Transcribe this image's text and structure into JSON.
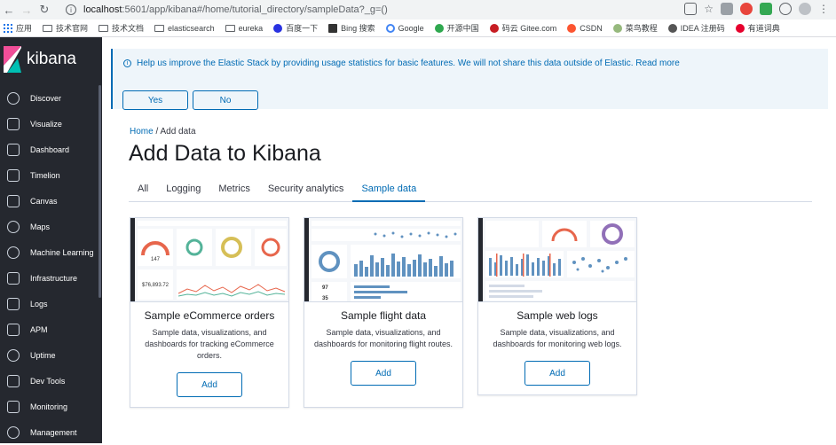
{
  "browser": {
    "url_host": "localhost",
    "url_rest": ":5601/app/kibana#/home/tutorial_directory/sampleData?_g=()",
    "bookmarks": [
      "应用",
      "技术官网",
      "技术文档",
      "elasticsearch",
      "eureka",
      "百度一下",
      "Bing 搜索",
      "Google",
      "开源中国",
      "码云 Gitee.com",
      "CSDN",
      "菜鸟教程",
      "IDEA 注册码",
      "有道词典"
    ]
  },
  "sidebar": {
    "logo": "kibana",
    "items": [
      "Discover",
      "Visualize",
      "Dashboard",
      "Timelion",
      "Canvas",
      "Maps",
      "Machine Learning",
      "Infrastructure",
      "Logs",
      "APM",
      "Uptime",
      "Dev Tools",
      "Monitoring",
      "Management"
    ]
  },
  "callout": {
    "text": "Help us improve the Elastic Stack by providing usage statistics for basic features. We will not share this data outside of Elastic. Read more",
    "yes": "Yes",
    "no": "No"
  },
  "breadcrumb": {
    "home": "Home",
    "sep": " / ",
    "current": "Add data"
  },
  "title": "Add Data to Kibana",
  "tabs": [
    "All",
    "Logging",
    "Metrics",
    "Security analytics",
    "Sample data"
  ],
  "active_tab": "Sample data",
  "cards": [
    {
      "title": "Sample eCommerce orders",
      "desc": "Sample data, visualizations, and dashboards for tracking eCommerce orders.",
      "button": "Add",
      "stat1": "147",
      "stat2": "$76,893.72"
    },
    {
      "title": "Sample flight data",
      "desc": "Sample data, visualizations, and dashboards for monitoring flight routes.",
      "button": "Add",
      "stat1": "97",
      "stat2": "35"
    },
    {
      "title": "Sample web logs",
      "desc": "Sample data, visualizations, and dashboards for monitoring web logs.",
      "button": "Add"
    }
  ]
}
